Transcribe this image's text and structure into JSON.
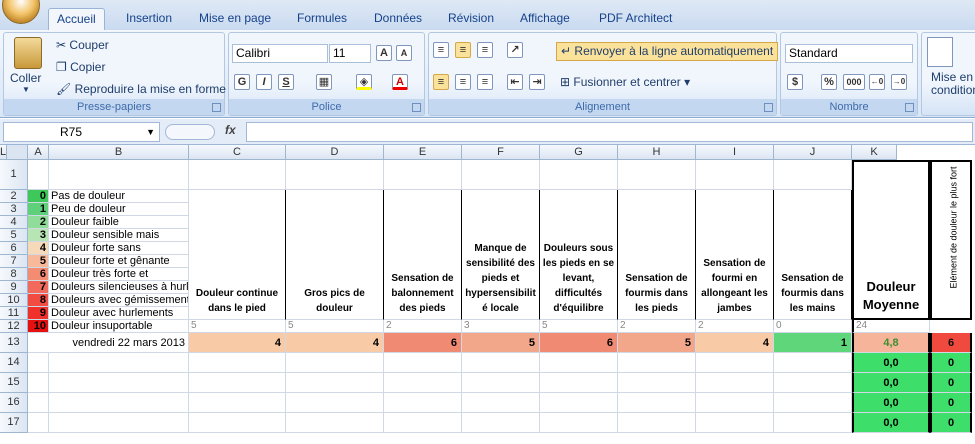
{
  "tabs": [
    "Accueil",
    "Insertion",
    "Mise en page",
    "Formules",
    "Données",
    "Révision",
    "Affichage",
    "PDF Architect"
  ],
  "ribbon": {
    "clipboard": {
      "paste": "Coller",
      "cut": "Couper",
      "copy": "Copier",
      "format_painter": "Reproduire la mise en forme",
      "label": "Presse-papiers"
    },
    "font": {
      "name": "Calibri",
      "size": "11",
      "bold": "G",
      "italic": "I",
      "underline": "S",
      "label": "Police",
      "grow": "A",
      "shrink": "A"
    },
    "alignment": {
      "wrap": "Renvoyer à la ligne automatiquement",
      "merge": "Fusionner et centrer",
      "label": "Alignement"
    },
    "number": {
      "format": "Standard",
      "percent": "%",
      "thousands": "000",
      "label": "Nombre"
    },
    "styles": {
      "conditional": "Mise en",
      "conditional2": "condition"
    }
  },
  "formula_bar": {
    "name_box": "R75",
    "fx": "fx",
    "formula": ""
  },
  "columns": [
    "A",
    "B",
    "C",
    "D",
    "E",
    "F",
    "G",
    "H",
    "I",
    "J",
    "K",
    "L"
  ],
  "rows": [
    "1",
    "2",
    "3",
    "4",
    "5",
    "6",
    "7",
    "8",
    "9",
    "10",
    "11",
    "12",
    "13",
    "14",
    "15",
    "16",
    "17"
  ],
  "scale": [
    {
      "level": "0",
      "label": "Pas de douleur",
      "color": "#3ec85a"
    },
    {
      "level": "1",
      "label": "Peu de douleur",
      "color": "#5fd07a"
    },
    {
      "level": "2",
      "label": "Douleur faible",
      "color": "#90dd9a"
    },
    {
      "level": "3",
      "label": "Douleur sensible mais",
      "color": "#b8e5b4"
    },
    {
      "level": "4",
      "label": "Douleur forte sans",
      "color": "#f6d9b8"
    },
    {
      "level": "5",
      "label": "Douleur forte et gênante",
      "color": "#f8b89a"
    },
    {
      "level": "6",
      "label": "Douleur très forte et",
      "color": "#f48c74"
    },
    {
      "level": "7",
      "label": "Douleurs silencieuses à hurler",
      "color": "#f26a5c"
    },
    {
      "level": "8",
      "label": "Douleurs avec gémissements",
      "color": "#f14b42"
    },
    {
      "level": "9",
      "label": "Douleur avec hurlements",
      "color": "#f0302a"
    },
    {
      "level": "10",
      "label": "Douleur insuportable",
      "color": "#e61010"
    }
  ],
  "headers": {
    "C": "Douleur continue dans le pied",
    "D": "Gros pics de douleur",
    "E": "Sensation de balonnement des pieds",
    "F": "Manque de sensibilité des pieds et hypersensibilit é locale",
    "G": "Douleurs sous les pieds en se levant, difficultés d'équilibre",
    "H": "Sensation de fourmis dans les pieds",
    "I": "Sensation de fourmi en allongeant les jambes",
    "J": "Sensation de fourmis dans les mains",
    "K": "Douleur Moyenne",
    "L": "Elément de douleur le plus fort"
  },
  "row12": {
    "C": "5",
    "D": "5",
    "E": "2",
    "F": "3",
    "G": "5",
    "H": "2",
    "I": "2",
    "J": "0",
    "K": "24"
  },
  "row13": {
    "date": "vendredi 22 mars 2013",
    "C": "4",
    "D": "4",
    "E": "6",
    "F": "5",
    "G": "6",
    "H": "5",
    "I": "4",
    "J": "1",
    "K": "4,8",
    "L": "6"
  },
  "rows_zero": [
    {
      "row": "14",
      "K": "0,0",
      "L": "0"
    },
    {
      "row": "15",
      "K": "0,0",
      "L": "0"
    },
    {
      "row": "16",
      "K": "0,0",
      "L": "0"
    },
    {
      "row": "17",
      "K": "0,0",
      "L": "0"
    }
  ]
}
